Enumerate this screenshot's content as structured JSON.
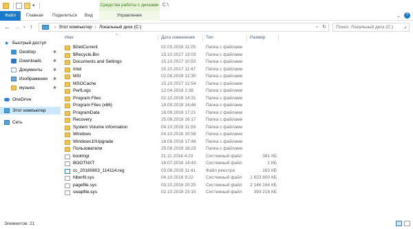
{
  "title_bar": {
    "context_tab_label": "Средства работы с дисками",
    "path": "C:\\"
  },
  "ribbon": {
    "file_tab": "Файл",
    "tabs": [
      "Главная",
      "Поделиться",
      "Вид"
    ],
    "manage_tab": "Управление"
  },
  "address": {
    "segments": [
      "Этот компьютер",
      "Локальный диск (C:)"
    ],
    "search_placeholder": "Поиск: Локальный диск (C:)"
  },
  "nav": {
    "quick_access": "Быстрый доступ",
    "items": [
      {
        "label": "Desktop",
        "icon": "desktop-icon",
        "pinned": true
      },
      {
        "label": "Downloads",
        "icon": "download-icon",
        "pinned": true
      },
      {
        "label": "Документы",
        "icon": "documents-icon",
        "pinned": true
      },
      {
        "label": "Изображения",
        "icon": "pictures-icon",
        "pinned": true
      },
      {
        "label": "музыка",
        "icon": "folder-icon",
        "pinned": true
      }
    ],
    "onedrive": "OneDrive",
    "this_pc": "Этот компьютер",
    "network": "Сеть"
  },
  "columns": {
    "name": "Имя",
    "date": "Дата изменения",
    "type": "Тип",
    "size": "Размер"
  },
  "files": [
    {
      "name": "$GetCurrent",
      "date": "02.03.2018 11:25",
      "type": "Папка с файлами",
      "size": "",
      "icon": "folder-icon"
    },
    {
      "name": "$Recycle.Bin",
      "date": "15.10.2017 13:03",
      "type": "Папка с файлами",
      "size": "",
      "icon": "folder-icon"
    },
    {
      "name": "Documents and Settings",
      "date": "15.10.2017 10:53",
      "type": "Папка с файлами",
      "size": "",
      "icon": "folder-icon"
    },
    {
      "name": "Intel",
      "date": "15.10.2017 11:47",
      "type": "Папка с файлами",
      "size": "",
      "icon": "folder-icon"
    },
    {
      "name": "MSI",
      "date": "02.08.2018 12:30",
      "type": "Папка с файлами",
      "size": "",
      "icon": "folder-icon"
    },
    {
      "name": "MSOCache",
      "date": "15.10.2017 12:54",
      "type": "Папка с файлами",
      "size": "",
      "icon": "folder-icon"
    },
    {
      "name": "PerfLogs",
      "date": "12.04.2018 2:38",
      "type": "Папка с файлами",
      "size": "",
      "icon": "folder-icon"
    },
    {
      "name": "Program Files",
      "date": "02.10.2018 14:31",
      "type": "Папка с файлами",
      "size": "",
      "icon": "folder-icon"
    },
    {
      "name": "Program Files (x86)",
      "date": "18.09.2018 14:46",
      "type": "Папка с файлами",
      "size": "",
      "icon": "folder-icon"
    },
    {
      "name": "ProgramData",
      "date": "16.09.2018 17:21",
      "type": "Папка с файлами",
      "size": "",
      "icon": "folder-icon"
    },
    {
      "name": "Recovery",
      "date": "25.08.2018 16:17",
      "type": "Папка с файлами",
      "size": "",
      "icon": "folder-icon"
    },
    {
      "name": "System Volume Information",
      "date": "04.10.2018 11:09",
      "type": "Папка с файлами",
      "size": "",
      "icon": "folder-icon"
    },
    {
      "name": "Windows",
      "date": "04.10.2018 10:58",
      "type": "Папка с файлами",
      "size": "",
      "icon": "folder-icon"
    },
    {
      "name": "Windows10Upgrade",
      "date": "18.09.2018 17:48",
      "type": "Папка с файлами",
      "size": "",
      "icon": "folder-icon"
    },
    {
      "name": "Пользователи",
      "date": "25.08.2018 16:23",
      "type": "Папка с файлами",
      "size": "",
      "icon": "folder-icon"
    },
    {
      "name": "bootmgr",
      "date": "21.11.2016 4:23",
      "type": "Системный файл",
      "size": "381 КБ",
      "icon": "file-icon"
    },
    {
      "name": "BOOTNXT",
      "date": "16.07.2016 14:43",
      "type": "Системный файл",
      "size": "1 КБ",
      "icon": "file-icon"
    },
    {
      "name": "cc_20180803_114114.reg",
      "date": "03.08.2018 11:41",
      "type": "Файл реестра",
      "size": "163 КБ",
      "icon": "reg-file-icon"
    },
    {
      "name": "hiberfil.sys",
      "date": "04.10.2018 9:22",
      "type": "Системный файл",
      "size": "1 623 800 КБ",
      "icon": "file-icon"
    },
    {
      "name": "pagefile.sys",
      "date": "03.10.2018 20:25",
      "type": "Системный файл",
      "size": "2 146 164 КБ",
      "icon": "file-icon"
    },
    {
      "name": "swapfile.sys",
      "date": "02.10.2018 23:15",
      "type": "Системный файл",
      "size": "393 216 КБ",
      "icon": "file-icon"
    }
  ],
  "status": {
    "items": "Элементов: 21"
  }
}
